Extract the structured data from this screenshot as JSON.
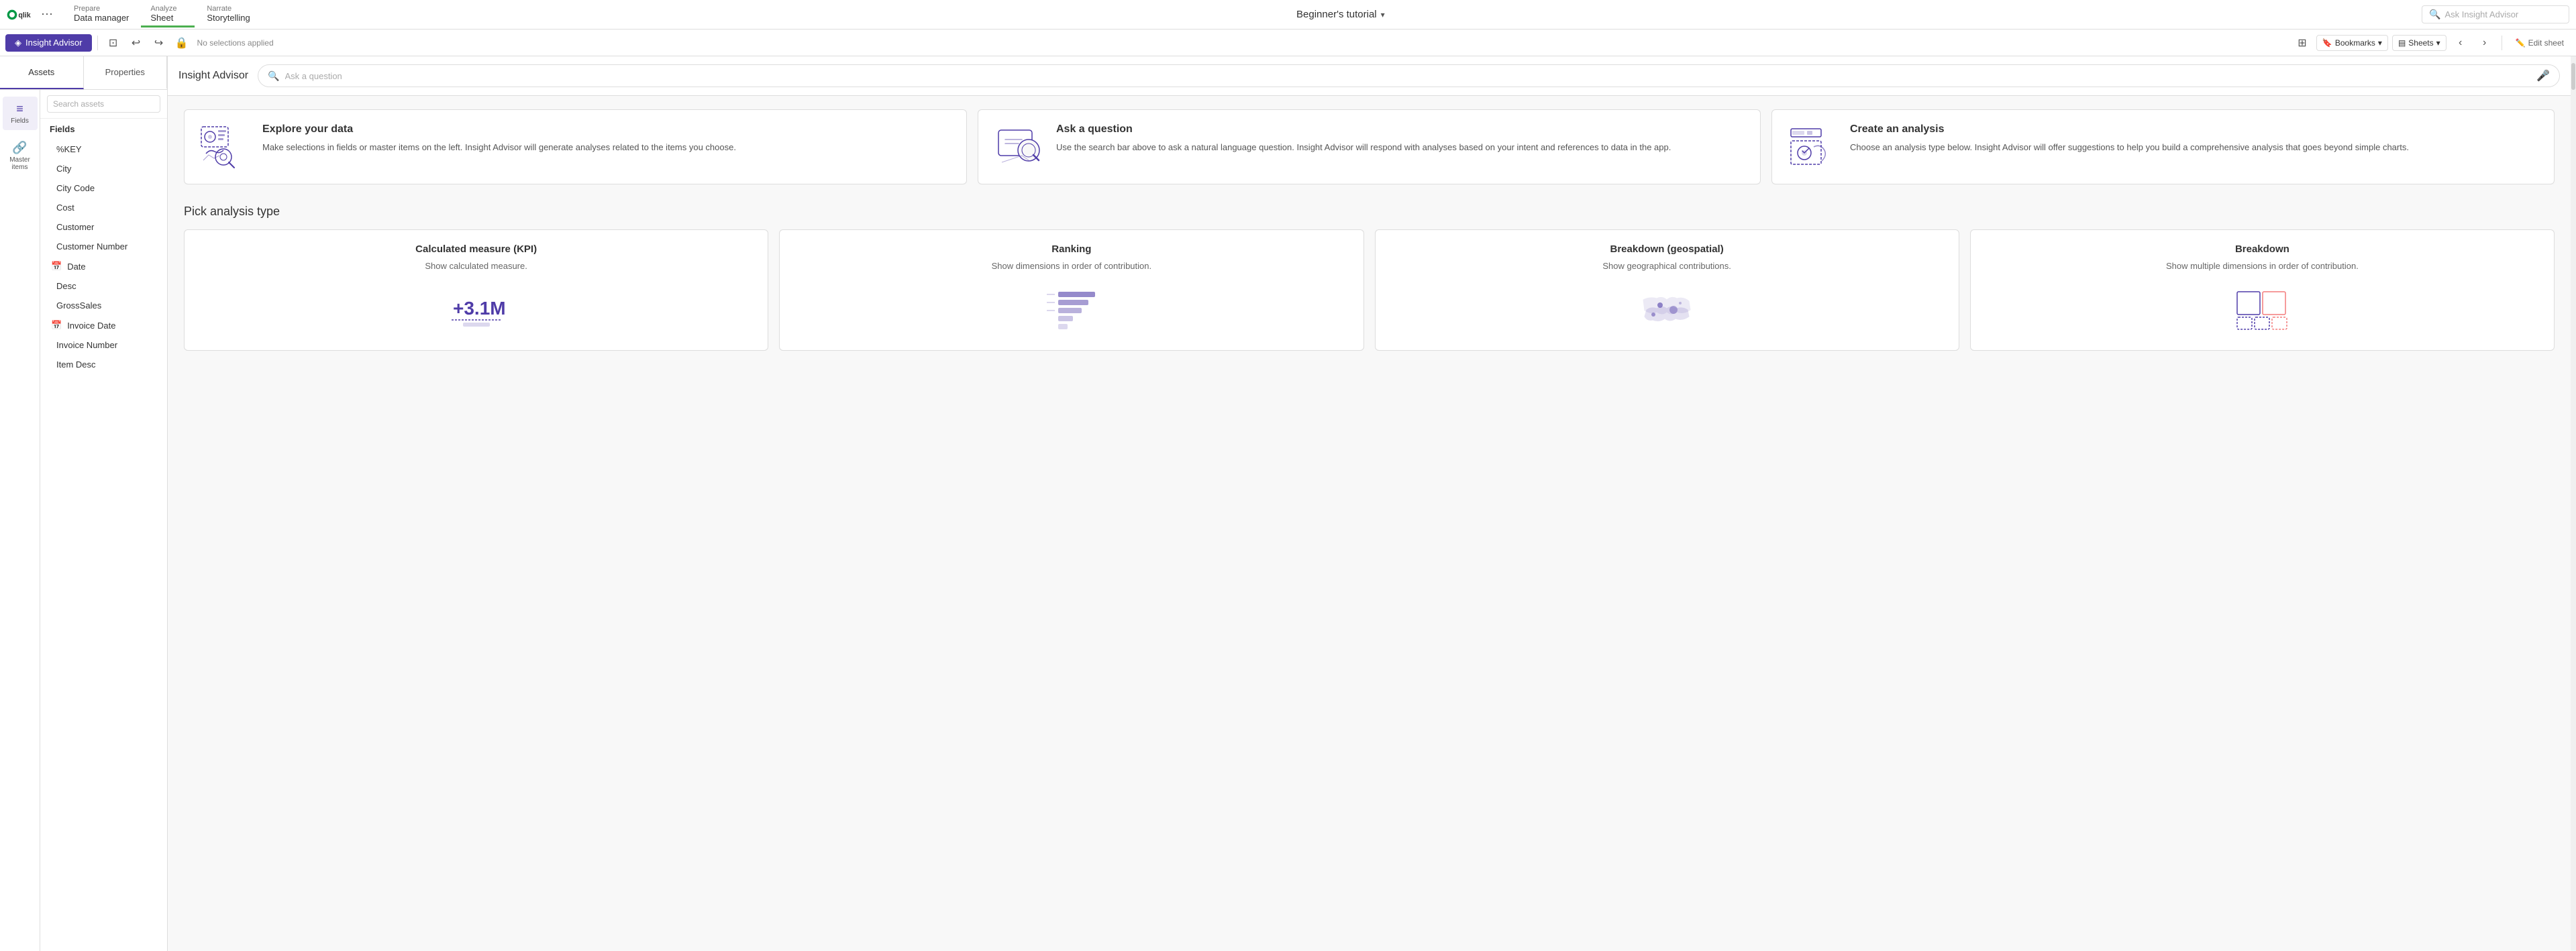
{
  "topNav": {
    "logo": "Qlik",
    "moreIcon": "⋯",
    "tabs": [
      {
        "id": "prepare",
        "top": "Prepare",
        "bottom": "Data manager",
        "active": false
      },
      {
        "id": "analyze",
        "top": "Analyze",
        "bottom": "Sheet",
        "active": true
      },
      {
        "id": "narrate",
        "top": "Narrate",
        "bottom": "Storytelling",
        "active": false
      }
    ],
    "title": "Beginner's tutorial",
    "searchPlaceholder": "Ask Insight Advisor"
  },
  "toolbar": {
    "insightAdvisorLabel": "Insight Advisor",
    "noSelections": "No selections applied",
    "bookmarksLabel": "Bookmarks",
    "sheetsLabel": "Sheets",
    "editSheetLabel": "Edit sheet"
  },
  "sidebar": {
    "assetsTab": "Assets",
    "propertiesTab": "Properties",
    "searchPlaceholder": "Search assets",
    "icons": [
      {
        "id": "fields",
        "symbol": "≡",
        "label": "Fields",
        "active": true
      },
      {
        "id": "master-items",
        "symbol": "🔗",
        "label": "Master items",
        "active": false
      }
    ],
    "fieldsHeading": "Fields",
    "fields": [
      {
        "name": "%KEY",
        "hasIcon": false,
        "iconType": ""
      },
      {
        "name": "City",
        "hasIcon": false,
        "iconType": ""
      },
      {
        "name": "City Code",
        "hasIcon": false,
        "iconType": ""
      },
      {
        "name": "Cost",
        "hasIcon": false,
        "iconType": ""
      },
      {
        "name": "Customer",
        "hasIcon": false,
        "iconType": ""
      },
      {
        "name": "Customer Number",
        "hasIcon": false,
        "iconType": ""
      },
      {
        "name": "Date",
        "hasIcon": true,
        "iconType": "calendar"
      },
      {
        "name": "Desc",
        "hasIcon": false,
        "iconType": ""
      },
      {
        "name": "GrossSales",
        "hasIcon": false,
        "iconType": ""
      },
      {
        "name": "Invoice Date",
        "hasIcon": true,
        "iconType": "calendar"
      },
      {
        "name": "Invoice Number",
        "hasIcon": false,
        "iconType": ""
      },
      {
        "name": "Item Desc",
        "hasIcon": false,
        "iconType": ""
      }
    ]
  },
  "insightAdvisor": {
    "title": "Insight Advisor",
    "searchPlaceholder": "Ask a question"
  },
  "introCards": [
    {
      "id": "explore",
      "title": "Explore your data",
      "description": "Make selections in fields or master items on the left. Insight Advisor will generate analyses related to the items you choose."
    },
    {
      "id": "ask",
      "title": "Ask a question",
      "description": "Use the search bar above to ask a natural language question. Insight Advisor will respond with analyses based on your intent and references to data in the app."
    },
    {
      "id": "create",
      "title": "Create an analysis",
      "description": "Choose an analysis type below. Insight Advisor will offer suggestions to help you build a comprehensive analysis that goes beyond simple charts."
    }
  ],
  "pickAnalysis": {
    "sectionTitle": "Pick analysis type",
    "cards": [
      {
        "id": "kpi",
        "title": "Calculated measure (KPI)",
        "description": "Show calculated measure.",
        "visualType": "kpi"
      },
      {
        "id": "ranking",
        "title": "Ranking",
        "description": "Show dimensions in order of contribution.",
        "visualType": "ranking"
      },
      {
        "id": "geospatial",
        "title": "Breakdown (geospatial)",
        "description": "Show geographical contributions.",
        "visualType": "geo"
      },
      {
        "id": "breakdown",
        "title": "Breakdown",
        "description": "Show multiple dimensions in order of contribution.",
        "visualType": "breakdown"
      }
    ]
  },
  "colors": {
    "brand": "#4f3ca8",
    "active": "#4CAF50",
    "text": "#333333",
    "subtext": "#666666",
    "border": "#dddddd",
    "background": "#f8f8f8"
  }
}
